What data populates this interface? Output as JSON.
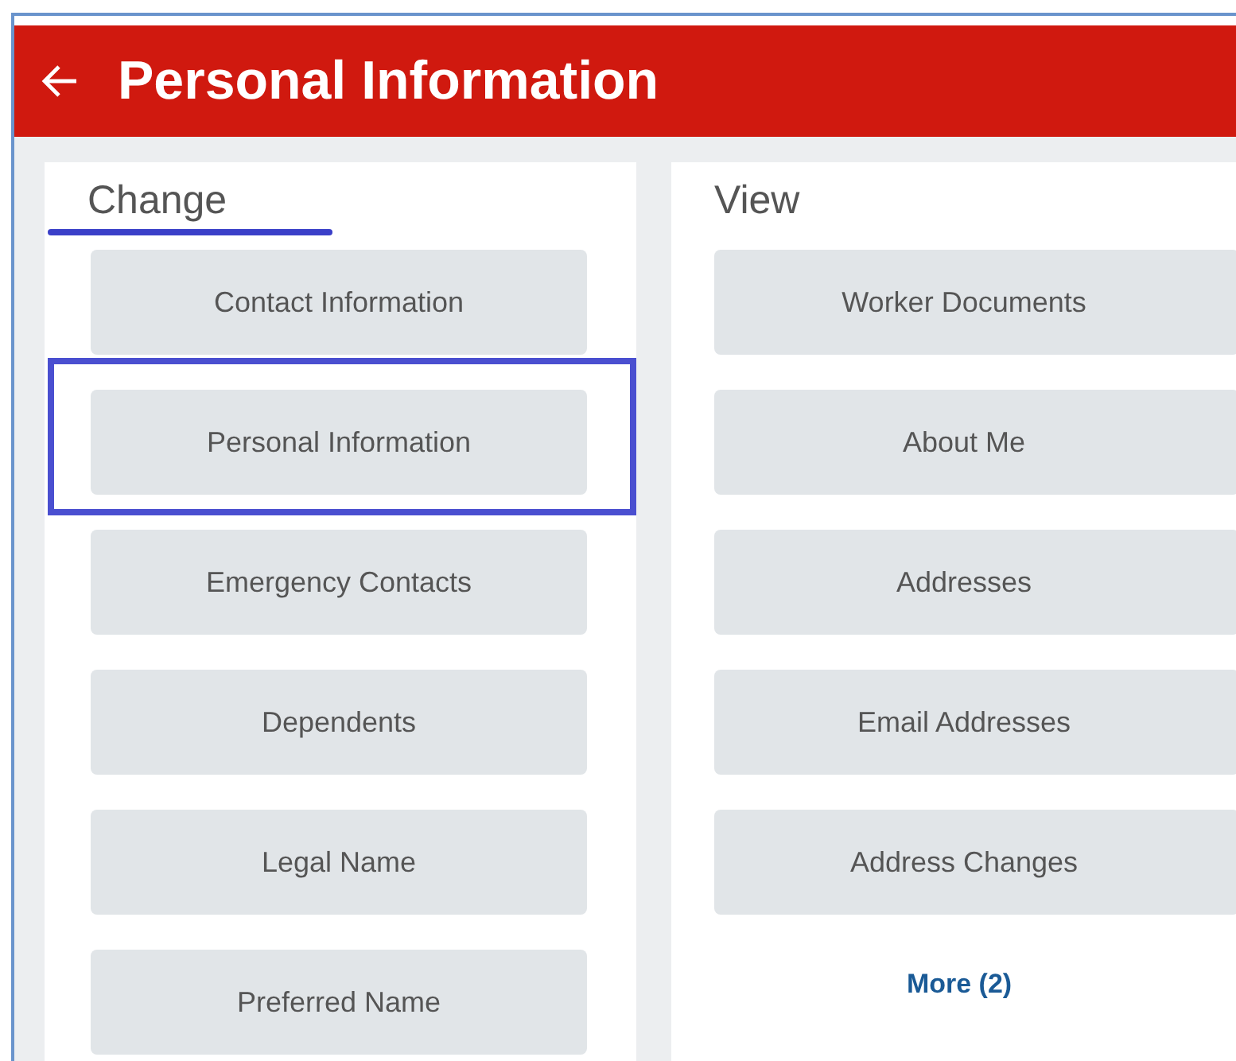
{
  "header": {
    "title": "Personal Information"
  },
  "change": {
    "heading": "Change",
    "heading_underlined": true,
    "items": [
      {
        "label": "Contact Information",
        "highlighted": false
      },
      {
        "label": "Personal Information",
        "highlighted": true
      },
      {
        "label": "Emergency Contacts",
        "highlighted": false
      },
      {
        "label": "Dependents",
        "highlighted": false
      },
      {
        "label": "Legal Name",
        "highlighted": false
      },
      {
        "label": "Preferred Name",
        "highlighted": false
      }
    ]
  },
  "view": {
    "heading": "View",
    "items": [
      {
        "label": "Worker Documents"
      },
      {
        "label": "About Me"
      },
      {
        "label": "Addresses"
      },
      {
        "label": "Email Addresses"
      },
      {
        "label": "Address Changes"
      }
    ],
    "more_link": "More (2)"
  }
}
